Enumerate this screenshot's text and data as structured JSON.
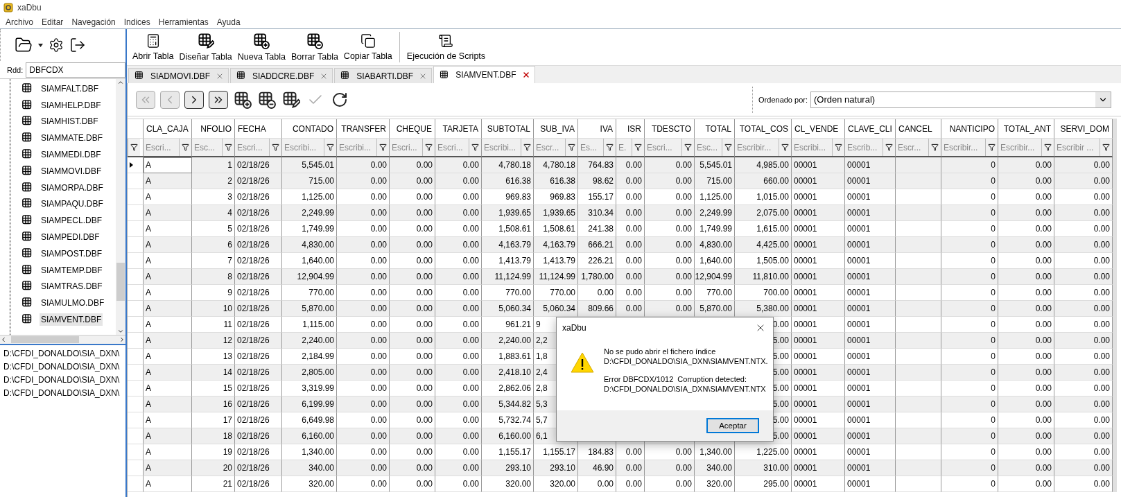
{
  "window": {
    "title": "xaDbu"
  },
  "menu": [
    "Archivo",
    "Editar",
    "Navegación",
    "Indices",
    "Herramientas",
    "Ayuda"
  ],
  "sidebar": {
    "rdd_label": "Rdd:",
    "rdd_value": "DBFCDX",
    "tables": [
      {
        "label": "SIAMFALT.DBF",
        "selected": false
      },
      {
        "label": "SIAMHELP.DBF",
        "selected": false
      },
      {
        "label": "SIAMHIST.DBF",
        "selected": false
      },
      {
        "label": "SIAMMATE.DBF",
        "selected": false
      },
      {
        "label": "SIAMMEDI.DBF",
        "selected": false
      },
      {
        "label": "SIAMMOVI.DBF",
        "selected": false
      },
      {
        "label": "SIAMORPA.DBF",
        "selected": false
      },
      {
        "label": "SIAMPAQU.DBF",
        "selected": false
      },
      {
        "label": "SIAMPECL.DBF",
        "selected": false
      },
      {
        "label": "SIAMPEDI.DBF",
        "selected": false
      },
      {
        "label": "SIAMPOST.DBF",
        "selected": false
      },
      {
        "label": "SIAMTEMP.DBF",
        "selected": false
      },
      {
        "label": "SIAMTRAS.DBF",
        "selected": false
      },
      {
        "label": "SIAMULMO.DBF",
        "selected": false
      },
      {
        "label": "SIAMVENT.DBF",
        "selected": true
      }
    ],
    "paths": [
      "D:\\CFDI_DONALDO\\SIA_DXN\\",
      "D:\\CFDI_DONALDO\\SIA_DXN\\",
      "D:\\CFDI_DONALDO\\SIA_DXN\\",
      "D:\\CFDI_DONALDO\\SIA_DXN\\"
    ]
  },
  "toolbar": [
    {
      "label": "Abrir Tabla",
      "kind": "open"
    },
    {
      "label": "Diseñar Tabla",
      "kind": "design"
    },
    {
      "label": "Nueva Tabla",
      "kind": "new"
    },
    {
      "label": "Borrar Tabla",
      "kind": "delete"
    },
    {
      "label": "Copiar Tabla",
      "kind": "copy"
    },
    {
      "label": "Ejecución de Scripts",
      "kind": "scripts"
    }
  ],
  "tabs": [
    {
      "label": "SIADMOVI.DBF",
      "selected": false
    },
    {
      "label": "SIADDCRE.DBF",
      "selected": false
    },
    {
      "label": "SIABARTI.DBF",
      "selected": false
    },
    {
      "label": "SIAMVENT.DBF",
      "selected": true
    }
  ],
  "navigator": [
    {
      "kind": "first",
      "disabled": true
    },
    {
      "kind": "prev",
      "disabled": true
    },
    {
      "kind": "next",
      "disabled": false
    },
    {
      "kind": "last",
      "disabled": false
    },
    {
      "kind": "insert",
      "disabled": false
    },
    {
      "kind": "remove",
      "disabled": false
    },
    {
      "kind": "edit",
      "disabled": false
    },
    {
      "kind": "post",
      "disabled": true
    },
    {
      "kind": "refresh",
      "disabled": false
    }
  ],
  "order": {
    "label": "Ordenado por:",
    "value": "(Orden natural)"
  },
  "table": {
    "columns": [
      {
        "label": "CLA_CAJA",
        "kind": "text",
        "placeholder": "Escri..."
      },
      {
        "label": "NFOLIO",
        "kind": "number",
        "placeholder": "Esc..."
      },
      {
        "label": "FECHA",
        "kind": "text",
        "placeholder": "Escri..."
      },
      {
        "label": "CONTADO",
        "kind": "number",
        "placeholder": "Escribi..."
      },
      {
        "label": "TRANSFER",
        "kind": "number",
        "placeholder": "Escribi..."
      },
      {
        "label": "CHEQUE",
        "kind": "number",
        "placeholder": "Escri..."
      },
      {
        "label": "TARJETA",
        "kind": "number",
        "placeholder": "Escri..."
      },
      {
        "label": "SUBTOTAL",
        "kind": "number",
        "placeholder": "Escribi..."
      },
      {
        "label": "SUB_IVA",
        "kind": "number",
        "placeholder": "Escr..."
      },
      {
        "label": "IVA",
        "kind": "number",
        "placeholder": "Es..."
      },
      {
        "label": "ISR",
        "kind": "number",
        "placeholder": "E."
      },
      {
        "label": "TDESCTO",
        "kind": "number",
        "placeholder": "Escri..."
      },
      {
        "label": "TOTAL",
        "kind": "number",
        "placeholder": "Esc..."
      },
      {
        "label": "TOTAL_COS",
        "kind": "number",
        "placeholder": "Escribir..."
      },
      {
        "label": "CL_VENDE",
        "kind": "text",
        "placeholder": "Escribi..."
      },
      {
        "label": "CLAVE_CLI",
        "kind": "text",
        "placeholder": "Escrib..."
      },
      {
        "label": "CANCEL",
        "kind": "text",
        "placeholder": "Escr..."
      },
      {
        "label": "NANTICIPO",
        "kind": "number",
        "placeholder": "Escribir..."
      },
      {
        "label": "TOTAL_ANT",
        "kind": "number",
        "placeholder": "Escribir..."
      },
      {
        "label": "SERVI_DOM",
        "kind": "number",
        "placeholder": "Escribir ..."
      }
    ],
    "rows": [
      {
        "selected": true,
        "cells": [
          "A",
          "1",
          "02/18/26",
          "5,545.01",
          "0.00",
          "0.00",
          "0.00",
          "4,780.18",
          "4,780.18",
          "764.83",
          "0.00",
          "0.00",
          "5,545.01",
          "4,985.00",
          "00001",
          "00001",
          null,
          "0",
          "0.00",
          "0.00"
        ]
      },
      {
        "selected": false,
        "cells": [
          "A",
          "2",
          "02/18/26",
          "715.00",
          "0.00",
          "0.00",
          "0.00",
          "616.38",
          "616.38",
          "98.62",
          "0.00",
          "0.00",
          "715.00",
          "660.00",
          "00001",
          "00001",
          null,
          "0",
          "0.00",
          "0.00"
        ]
      },
      {
        "selected": false,
        "cells": [
          "A",
          "3",
          "02/18/26",
          "1,125.00",
          "0.00",
          "0.00",
          "0.00",
          "969.83",
          "969.83",
          "155.17",
          "0.00",
          "0.00",
          "1,125.00",
          "1,015.00",
          "00001",
          "00001",
          null,
          "0",
          "0.00",
          "0.00"
        ]
      },
      {
        "selected": false,
        "cells": [
          "A",
          "4",
          "02/18/26",
          "2,249.99",
          "0.00",
          "0.00",
          "0.00",
          "1,939.65",
          "1,939.65",
          "310.34",
          "0.00",
          "0.00",
          "2,249.99",
          "2,075.00",
          "00001",
          "00001",
          null,
          "0",
          "0.00",
          "0.00"
        ]
      },
      {
        "selected": false,
        "cells": [
          "A",
          "5",
          "02/18/26",
          "1,749.99",
          "0.00",
          "0.00",
          "0.00",
          "1,508.61",
          "1,508.61",
          "241.38",
          "0.00",
          "0.00",
          "1,749.99",
          "1,615.00",
          "00001",
          "00001",
          null,
          "0",
          "0.00",
          "0.00"
        ]
      },
      {
        "selected": false,
        "cells": [
          "A",
          "6",
          "02/18/26",
          "4,830.00",
          "0.00",
          "0.00",
          "0.00",
          "4,163.79",
          "4,163.79",
          "666.21",
          "0.00",
          "0.00",
          "4,830.00",
          "4,425.00",
          "00001",
          "00001",
          null,
          "0",
          "0.00",
          "0.00"
        ]
      },
      {
        "selected": false,
        "cells": [
          "A",
          "7",
          "02/18/26",
          "1,640.00",
          "0.00",
          "0.00",
          "0.00",
          "1,413.79",
          "1,413.79",
          "226.21",
          "0.00",
          "0.00",
          "1,640.00",
          "1,505.00",
          "00001",
          "00001",
          null,
          "0",
          "0.00",
          "0.00"
        ]
      },
      {
        "selected": false,
        "cells": [
          "A",
          "8",
          "02/18/26",
          "12,904.99",
          "0.00",
          "0.00",
          "0.00",
          "11,124.99",
          "11,124.99",
          "1,780.00",
          "0.00",
          "0.00",
          "12,904.99",
          "11,810.00",
          "00001",
          "00001",
          null,
          "0",
          "0.00",
          "0.00"
        ]
      },
      {
        "selected": false,
        "cells": [
          "A",
          "9",
          "02/18/26",
          "770.00",
          "0.00",
          "0.00",
          "0.00",
          "770.00",
          "770.00",
          "0.00",
          "0.00",
          "0.00",
          "770.00",
          "700.00",
          "00001",
          "00001",
          null,
          "0",
          "0.00",
          "0.00"
        ]
      },
      {
        "selected": false,
        "cells": [
          "A",
          "10",
          "02/18/26",
          "5,870.00",
          "0.00",
          "0.00",
          "0.00",
          "5,060.34",
          "5,060.34",
          "809.66",
          "0.00",
          "0.00",
          "5,870.00",
          "5,380.00",
          "00001",
          "00001",
          null,
          "0",
          "0.00",
          "0.00"
        ]
      },
      {
        "selected": false,
        "cells": [
          "A",
          "11",
          "02/18/26",
          "1,115.00",
          "0.00",
          "0.00",
          "0.00",
          "961.21",
          "9",
          null,
          null,
          null,
          null,
          "0.00",
          "00001",
          "00001",
          null,
          "0",
          "0.00",
          "0.00"
        ]
      },
      {
        "selected": false,
        "cells": [
          "A",
          "12",
          "02/18/26",
          "2,240.00",
          "0.00",
          "0.00",
          "0.00",
          "2,240.00",
          "2,2",
          null,
          null,
          null,
          null,
          "5.00",
          "00001",
          "00001",
          null,
          "0",
          "0.00",
          "0.00"
        ]
      },
      {
        "selected": false,
        "cells": [
          "A",
          "13",
          "02/18/26",
          "2,184.99",
          "0.00",
          "0.00",
          "0.00",
          "1,883.61",
          "1,8",
          null,
          null,
          null,
          null,
          "5.00",
          "00001",
          "00001",
          null,
          "0",
          "0.00",
          "0.00"
        ]
      },
      {
        "selected": false,
        "cells": [
          "A",
          "14",
          "02/18/26",
          "2,805.00",
          "0.00",
          "0.00",
          "0.00",
          "2,418.10",
          "2,4",
          null,
          null,
          null,
          null,
          "5.00",
          "00001",
          "00001",
          null,
          "0",
          "0.00",
          "0.00"
        ]
      },
      {
        "selected": false,
        "cells": [
          "A",
          "15",
          "02/18/26",
          "3,319.99",
          "0.00",
          "0.00",
          "0.00",
          "2,862.06",
          "2,8",
          null,
          null,
          null,
          null,
          "5.00",
          "00001",
          "00001",
          null,
          "0",
          "0.00",
          "0.00"
        ]
      },
      {
        "selected": false,
        "cells": [
          "A",
          "16",
          "02/18/26",
          "6,199.99",
          "0.00",
          "0.00",
          "0.00",
          "5,344.82",
          "5,3",
          null,
          null,
          null,
          null,
          "5.00",
          "00001",
          "00001",
          null,
          "0",
          "0.00",
          "0.00"
        ]
      },
      {
        "selected": false,
        "cells": [
          "A",
          "17",
          "02/18/26",
          "6,649.98",
          "0.00",
          "0.00",
          "0.00",
          "5,732.74",
          "5,7",
          null,
          null,
          null,
          null,
          "5.00",
          "00001",
          "00001",
          null,
          "0",
          "0.00",
          "0.00"
        ]
      },
      {
        "selected": false,
        "cells": [
          "A",
          "18",
          "02/18/26",
          "6,160.00",
          "0.00",
          "0.00",
          "0.00",
          "6,160.00",
          "6,1",
          null,
          null,
          null,
          null,
          "5.00",
          "00001",
          "00001",
          null,
          "0",
          "0.00",
          "0.00"
        ]
      },
      {
        "selected": false,
        "cells": [
          "A",
          "19",
          "02/18/26",
          "1,340.00",
          "0.00",
          "0.00",
          "0.00",
          "1,155.17",
          "1,155.17",
          "184.83",
          "0.00",
          "0.00",
          "1,340.00",
          "1,225.00",
          "00001",
          "00001",
          null,
          "0",
          "0.00",
          "0.00"
        ]
      },
      {
        "selected": false,
        "cells": [
          "A",
          "20",
          "02/18/26",
          "340.00",
          "0.00",
          "0.00",
          "0.00",
          "293.10",
          "293.10",
          "46.90",
          "0.00",
          "0.00",
          "340.00",
          "310.00",
          "00001",
          "00001",
          null,
          "0",
          "0.00",
          "0.00"
        ]
      },
      {
        "selected": false,
        "cells": [
          "A",
          "21",
          "02/18/26",
          "320.00",
          "0.00",
          "0.00",
          "0.00",
          "320.00",
          "320.00",
          "0.00",
          "0.00",
          "0.00",
          "320.00",
          "295.00",
          "00001",
          "00001",
          null,
          "0",
          "0.00",
          "0.00"
        ]
      }
    ]
  },
  "dialog": {
    "title": "xaDbu",
    "paragraphs": [
      "No se pudo abrir el fichero índice\nD:\\CFDI_DONALDO\\SIA_DXN\\SIAMVENT.NTX.",
      "Error DBFCDX/1012  Corruption detected:\nD:\\CFDI_DONALDO\\SIA_DXN\\SIAMVENT.NTX"
    ],
    "button": "Aceptar"
  }
}
